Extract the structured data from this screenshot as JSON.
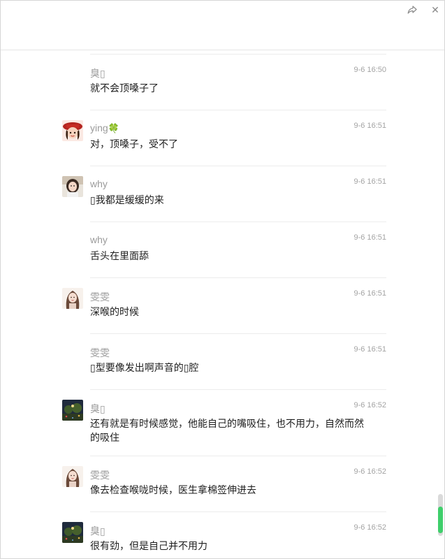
{
  "window": {
    "share_icon": "share-forward-icon",
    "close_glyph": "✕"
  },
  "messages": [
    {
      "name": "臭▯",
      "time": "9-6 16:50",
      "text": "就不会顶嗓子了",
      "avatar": "none"
    },
    {
      "name": "ying",
      "name_suffix": "🍀",
      "time": "9-6 16:51",
      "text": "对，顶嗓子，受不了",
      "avatar": "girl-red-hat-avatar"
    },
    {
      "name": "why",
      "time": "9-6 16:51",
      "text": "▯我都是缓缓的来",
      "avatar": "girl-photo-avatar"
    },
    {
      "name": "why",
      "time": "9-6 16:51",
      "text": "舌头在里面舔",
      "avatar": "none"
    },
    {
      "name": "雯雯",
      "time": "9-6 16:51",
      "text": "深喉的时候",
      "avatar": "long-hair-girl-avatar"
    },
    {
      "name": "雯雯",
      "time": "9-6 16:51",
      "text": "▯型要像发出啊声音的▯腔",
      "avatar": "none"
    },
    {
      "name": "臭▯",
      "time": "9-6 16:52",
      "text": "还有就是有时候感觉，他能自己的嘴吸住，也不用力，自然而然的吸住",
      "avatar": "night-tree-avatar"
    },
    {
      "name": "雯雯",
      "time": "9-6 16:52",
      "text": "像去检查喉咙时候，医生拿棉签伸进去",
      "avatar": "long-hair-girl-avatar"
    },
    {
      "name": "臭▯",
      "time": "9-6 16:52",
      "text": "很有劲，但是自己并不用力",
      "avatar": "night-tree-avatar"
    }
  ]
}
